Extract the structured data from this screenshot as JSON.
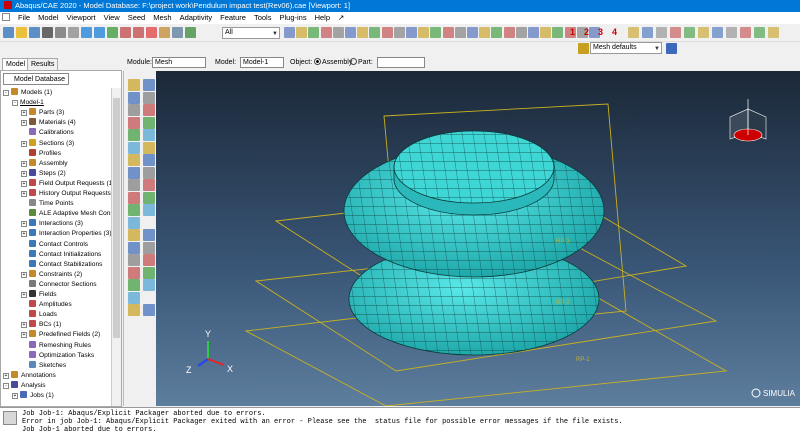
{
  "window": {
    "title": "Abaqus/CAE 2020 - Model Database: F:\\project work\\Pendulum impact test(Rev06).cae [Viewport: 1]"
  },
  "menu": [
    "File",
    "Model",
    "Viewport",
    "View",
    "Seed",
    "Mesh",
    "Adaptivity",
    "Feature",
    "Tools",
    "Plug-ins",
    "Help"
  ],
  "toolbar": {
    "selection_filter": "All",
    "mesh_defaults": "Mesh defaults",
    "numbers": [
      "1",
      "2",
      "3",
      "4"
    ]
  },
  "context": {
    "module_label": "Module:",
    "module": "Mesh",
    "model_label": "Model:",
    "model": "Model-1",
    "object_label": "Object:",
    "assembly": "Assembly",
    "part": "Part:"
  },
  "tabs": [
    "Model",
    "Results"
  ],
  "tree_header": "Model Database",
  "tree": [
    {
      "label": "Models (1)",
      "indent": 0,
      "ex": "-",
      "icon": "#c48a2a"
    },
    {
      "label": "Model-1",
      "indent": 1,
      "ex": "-",
      "icon": "",
      "underline": true
    },
    {
      "label": "Parts (3)",
      "indent": 2,
      "ex": "+",
      "icon": "#c48a2a"
    },
    {
      "label": "Materials (4)",
      "indent": 2,
      "ex": "+",
      "icon": "#7a5c3a"
    },
    {
      "label": "Calibrations",
      "indent": 2,
      "ex": "",
      "icon": "#8a6ab8"
    },
    {
      "label": "Sections (3)",
      "indent": 2,
      "ex": "+",
      "icon": "#d0a020"
    },
    {
      "label": "Profiles",
      "indent": 2,
      "ex": "",
      "icon": "#b04030"
    },
    {
      "label": "Assembly",
      "indent": 2,
      "ex": "+",
      "icon": "#c48a2a"
    },
    {
      "label": "Steps (2)",
      "indent": 2,
      "ex": "+",
      "icon": "#4a4a9a"
    },
    {
      "label": "Field Output Requests (1)",
      "indent": 2,
      "ex": "+",
      "icon": "#c04848"
    },
    {
      "label": "History Output Requests (",
      "indent": 2,
      "ex": "+",
      "icon": "#c04848"
    },
    {
      "label": "Time Points",
      "indent": 2,
      "ex": "",
      "icon": "#888888"
    },
    {
      "label": "ALE Adaptive Mesh Const",
      "indent": 2,
      "ex": "",
      "icon": "#5a8a3a"
    },
    {
      "label": "Interactions (3)",
      "indent": 2,
      "ex": "+",
      "icon": "#3a7ab8"
    },
    {
      "label": "Interaction Properties (3)",
      "indent": 2,
      "ex": "+",
      "icon": "#3a7ab8"
    },
    {
      "label": "Contact Controls",
      "indent": 2,
      "ex": "",
      "icon": "#3a7ab8"
    },
    {
      "label": "Contact Initializations",
      "indent": 2,
      "ex": "",
      "icon": "#3a7ab8"
    },
    {
      "label": "Contact Stabilizations",
      "indent": 2,
      "ex": "",
      "icon": "#3a7ab8"
    },
    {
      "label": "Constraints (2)",
      "indent": 2,
      "ex": "+",
      "icon": "#c48a2a"
    },
    {
      "label": "Connector Sections",
      "indent": 2,
      "ex": "",
      "icon": "#7a7a7a"
    },
    {
      "label": "Fields",
      "indent": 2,
      "ex": "+",
      "icon": "#333333"
    },
    {
      "label": "Amplitudes",
      "indent": 2,
      "ex": "",
      "icon": "#c04848"
    },
    {
      "label": "Loads",
      "indent": 2,
      "ex": "",
      "icon": "#c04848"
    },
    {
      "label": "BCs (1)",
      "indent": 2,
      "ex": "+",
      "icon": "#c04848"
    },
    {
      "label": "Predefined Fields (2)",
      "indent": 2,
      "ex": "+",
      "icon": "#c48a2a"
    },
    {
      "label": "Remeshing Rules",
      "indent": 2,
      "ex": "",
      "icon": "#8a6ab8"
    },
    {
      "label": "Optimization Tasks",
      "indent": 2,
      "ex": "",
      "icon": "#8a6ab8"
    },
    {
      "label": "Sketches",
      "indent": 2,
      "ex": "",
      "icon": "#5a8ab8"
    },
    {
      "label": "Annotations",
      "indent": 0,
      "ex": "+",
      "icon": "#c48a2a"
    },
    {
      "label": "Analysis",
      "indent": 0,
      "ex": "-",
      "icon": "#4a4a9a"
    },
    {
      "label": "Jobs (1)",
      "indent": 1,
      "ex": "+",
      "icon": "#4a6ab8"
    }
  ],
  "triad": {
    "x": "X",
    "y": "Y",
    "z": "Z"
  },
  "brand": "SIMULIA",
  "messages": [
    "Job Job-1: Abaqus/Explicit Packager aborted due to errors.",
    "Error in job Job-1: Abaqus/Explicit Packager exited with an error - Please see the  status file for possible error messages if the file exists.",
    "Job Job-1 aborted due to errors."
  ],
  "colors": {
    "mesh_fill": "#36cfcf",
    "mesh_line": "#0a3a3a",
    "ref_plane": "#c8b020",
    "titlebar": "#0078d7"
  }
}
